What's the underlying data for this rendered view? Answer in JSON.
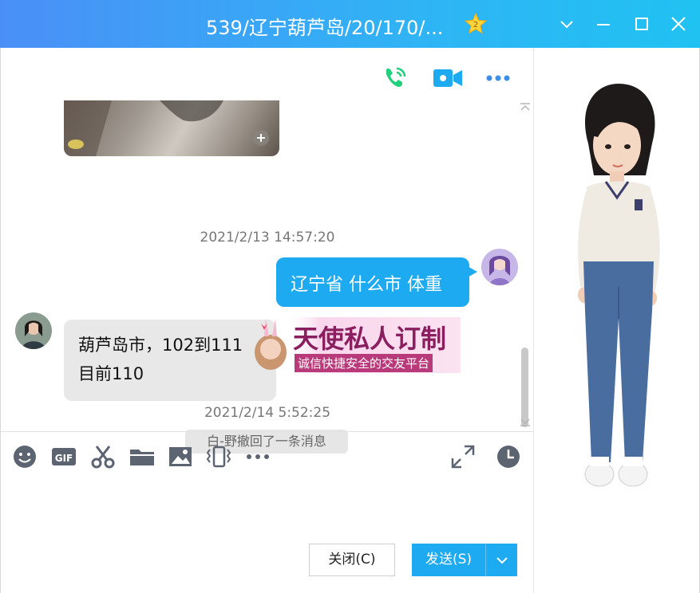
{
  "window": {
    "title": "539/辽宁葫芦岛/20/170/...",
    "badge": "2"
  },
  "messages": {
    "timestamp_1": "2021/2/13 14:57:20",
    "outgoing_text": "辽宁省 什么市 体重",
    "incoming_line_1": "葫芦岛市，102到111",
    "incoming_line_2": "目前110",
    "timestamp_2": "2021/2/14 5:52:25",
    "recall_notice": "白-野撤回了一条消息"
  },
  "overlay_ad": {
    "title": "天使私人订制",
    "subtitle": "诚信快捷安全的交友平台"
  },
  "buttons": {
    "close_label": "关闭(C)",
    "send_label": "发送(S)"
  },
  "colors": {
    "accent": "#1eaaf1",
    "call_green": "#21d07a",
    "video_blue": "#1eaaf1"
  }
}
